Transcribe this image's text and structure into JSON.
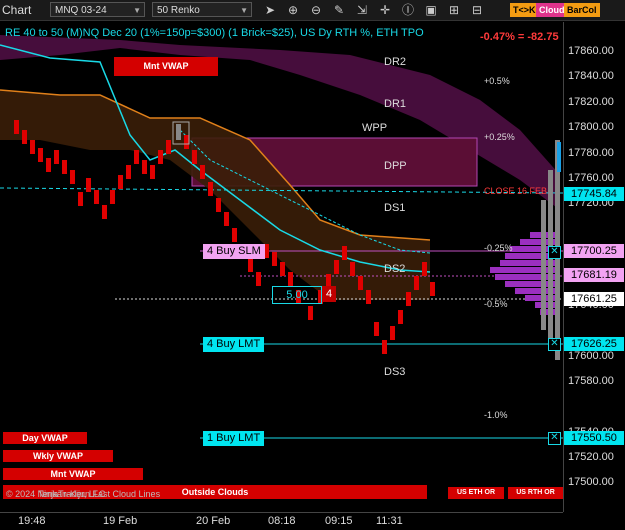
{
  "toolbar": {
    "title": "Chart",
    "instrument": "MNQ 03-24",
    "bar_type": "50 Renko",
    "tk_label": "T<>K",
    "cloud_label": "Cloud",
    "barcol_label": "BarCol",
    "icons": [
      "cursor-icon",
      "zoom-in-icon",
      "zoom-out-icon",
      "draw-icon",
      "expand-icon",
      "cursor-crosshair-icon",
      "text-icon",
      "notebook-icon",
      "settings-icon",
      "strategy-icon"
    ]
  },
  "header": {
    "info": "RE 40 to 50 (M)NQ Dec 20 (1%=150p=$300) (1 Brick=$25), US Dy RTH %, ETH TPO",
    "change": "-0.47% = -82.75"
  },
  "price_axis": {
    "labels": [
      "17860.00",
      "17840.00",
      "17820.00",
      "17800.00",
      "17780.00",
      "17760.00",
      "17720.00",
      "17640.00",
      "17600.00",
      "17580.00",
      "17540.00",
      "17520.00",
      "17500.00"
    ],
    "tags": [
      {
        "text": "17745.84",
        "color": "#00e5f0"
      },
      {
        "text": "17700.25",
        "color": "#f2a3f2"
      },
      {
        "text": "17681.19",
        "color": "#f2a3f2"
      },
      {
        "text": "17661.25",
        "color": "#ffffff"
      },
      {
        "text": "17626.25",
        "color": "#00e5f0"
      },
      {
        "text": "17550.50",
        "color": "#00e5f0"
      }
    ]
  },
  "time_axis": {
    "labels": [
      "19:48",
      "19 Feb",
      "20 Feb",
      "08:18",
      "09:15",
      "11:31"
    ]
  },
  "levels": {
    "dr2": "DR2",
    "dr1": "DR1",
    "wpp": "WPP",
    "dpp": "DPP",
    "ds1": "DS1",
    "ds2": "DS2",
    "ds3": "DS3",
    "p05": "+0.5%",
    "p025": "+0.25%",
    "close16": "CLOSE 16 FEB",
    "m025": "-0.25%",
    "m05": "-0.5%",
    "m1": "-1.0%"
  },
  "boxes": {
    "mnt_vwap_top": "Mnt VWAP",
    "day_vwap": "Day VWAP",
    "wkly_vwap": "Wkly VWAP",
    "mnt_vwap": "Mnt VWAP",
    "outside_clouds": "Outside Clouds",
    "us_eth_or": "US ETH OR",
    "us_rth_or": "US RTH OR",
    "copyright": "© 2024 NinjaTrader, LLC",
    "tenkan_kijun": "Tenkan-Kijun Fast Cloud Lines"
  },
  "orders": {
    "buy_slm": "4 Buy SLM",
    "buy_lmt_4": "4 Buy LMT",
    "buy_lmt_1": "1 Buy LMT",
    "qty_price": "5.00",
    "qty_count": "4"
  }
}
